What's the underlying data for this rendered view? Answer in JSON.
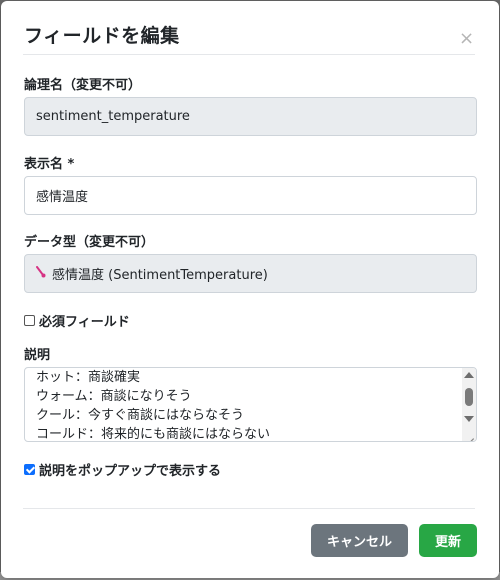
{
  "modal": {
    "title": "フィールドを編集",
    "close_glyph": "×"
  },
  "logical_name": {
    "label": "論理名（変更不可）",
    "value": "sentiment_temperature"
  },
  "display_name": {
    "label": "表示名 *",
    "value": "感情温度"
  },
  "data_type": {
    "label": "データ型（変更不可）",
    "icon": "thermometer-icon",
    "value": "感情温度 (SentimentTemperature)"
  },
  "required": {
    "label": "必須フィールド",
    "checked": false
  },
  "description": {
    "label": "説明",
    "lines": [
      "ホット：商談確実",
      "ウォーム：商談になりそう",
      "クール：今すぐ商談にはならなそう",
      "コールド：将来的にも商談にはならない"
    ]
  },
  "show_popup": {
    "label": "説明をポップアップで表示する",
    "checked": true
  },
  "buttons": {
    "cancel": "キャンセル",
    "update": "更新"
  },
  "colors": {
    "cancel_button": "#6c757d",
    "update_button": "#28a745",
    "readonly_bg": "#e9ecef",
    "thermometer_icon": "#d63384"
  }
}
